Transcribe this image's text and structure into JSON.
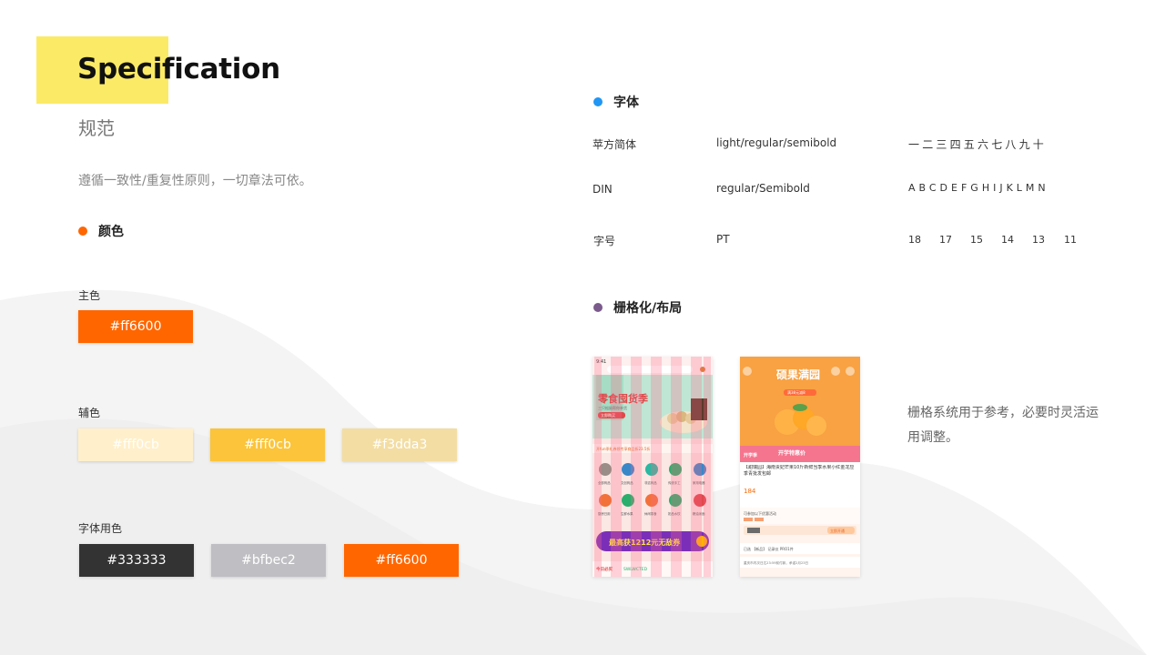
{
  "header": {
    "title": "Specification",
    "subtitle": "规范",
    "description": "遵循一致性/重复性原则，一切章法可依。"
  },
  "colors_section": {
    "heading": "颜色",
    "primary_label": "主色",
    "primary_swatch": {
      "hex": "#ff6600",
      "bg": "#ff6600",
      "fg": "#ffffff"
    },
    "secondary_label": "辅色",
    "secondary_swatches": [
      {
        "hex": "#fff0cb",
        "bg": "#fff0cb",
        "fg": "#ffffff"
      },
      {
        "hex": "#fff0cb",
        "bg": "#fbc43a",
        "fg": "#ffffff"
      },
      {
        "hex": "#f3dda3",
        "bg": "#f3dda3",
        "fg": "#ffffff"
      }
    ],
    "text_label": "字体用色",
    "text_swatches": [
      {
        "hex": "#333333",
        "bg": "#333333",
        "fg": "#ffffff"
      },
      {
        "hex": "#bfbec2",
        "bg": "#bfbec2",
        "fg": "#ffffff"
      },
      {
        "hex": "#ff6600",
        "bg": "#ff6600",
        "fg": "#ffffff"
      }
    ],
    "dot_color": "#ff6600"
  },
  "font_section": {
    "heading": "字体",
    "dot_color": "#2196f3",
    "rows": [
      {
        "name": "苹方简体",
        "weights": "light/regular/semibold",
        "sample": "一二三四五六七八九十"
      },
      {
        "name": "DIN",
        "weights": "regular/Semibold",
        "sample": "ABCDEFGHIJKLMN"
      },
      {
        "name": "字号",
        "weights": "PT",
        "sizes": [
          "18",
          "17",
          "15",
          "14",
          "13",
          "11"
        ]
      }
    ]
  },
  "grid_section": {
    "heading": "栅格化/布局",
    "dot_color": "#7b5a8c",
    "note": "栅格系统用于参考，必要时灵活运用调整。"
  },
  "phone1": {
    "time": "9:41",
    "banner_title": "零食囤货季",
    "banner_sub": "三只松鼠帮你补货",
    "banner_btn": "立即购买",
    "notice": "开fun季礼券领专享商品折23.5折",
    "categories": [
      "全部商品",
      "文创商品",
      "非遗商品",
      "传统手工",
      "家用电器",
      "厨房日用",
      "生鲜水果",
      "休闲零食",
      "奶品水饮",
      "粮油米面"
    ],
    "promo": "最高获1212元无敌券",
    "footer_left": "今日必买",
    "footer_right": "SWLWCTED"
  },
  "phone2": {
    "banner_title": "硕果满园",
    "banner_btn": "满38元减8",
    "strip_title": "开学特惠价",
    "product_title": "【甜瑞园】海南贵妃芒果10斤新鲜当季水果小红金龙应季青批发包邮",
    "price": "184",
    "row1": "可参加以下优惠活动",
    "row2": "立即开通",
    "row3": "已选 【新品】 记录仪 PRO1件",
    "row4": "重庆市内次日达23:59前付款，承诺2月23日"
  }
}
